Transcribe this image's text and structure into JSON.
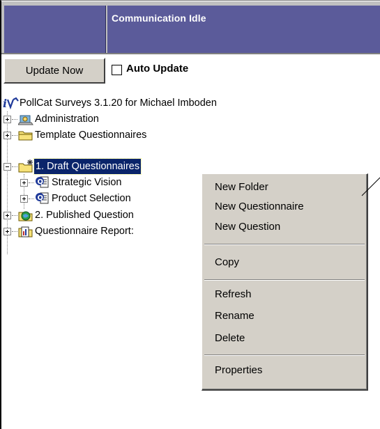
{
  "header": {
    "status": "Communication Idle"
  },
  "toolbar": {
    "update_label": "Update Now",
    "auto_update_label": "Auto Update",
    "auto_update_checked": false
  },
  "tree": {
    "root": "PollCat Surveys 3.1.20 for Michael Imboden",
    "items": [
      {
        "label": "Administration",
        "icon": "administration-icon"
      },
      {
        "label": "Template Questionnaires",
        "icon": "folder-icon"
      },
      {
        "label": "1. Draft Questionnaires",
        "icon": "draft-folder-icon",
        "selected": true,
        "children": [
          {
            "label": "Strategic Vision",
            "icon": "questionnaire-icon"
          },
          {
            "label": "Product Selection",
            "icon": "questionnaire-icon"
          }
        ]
      },
      {
        "label": "2. Published Question",
        "icon": "published-icon"
      },
      {
        "label": "Questionnaire Report:",
        "icon": "reports-icon"
      }
    ]
  },
  "context_menu": {
    "groups": [
      [
        "New Folder",
        "New Questionnaire",
        "New Question"
      ],
      [
        "Copy"
      ],
      [
        "Refresh",
        "Rename",
        "Delete"
      ],
      [
        "Properties"
      ]
    ]
  },
  "colors": {
    "header_bg": "#5b5b9a",
    "selection_bg": "#0a246a",
    "menu_bg": "#d4d0c8"
  }
}
